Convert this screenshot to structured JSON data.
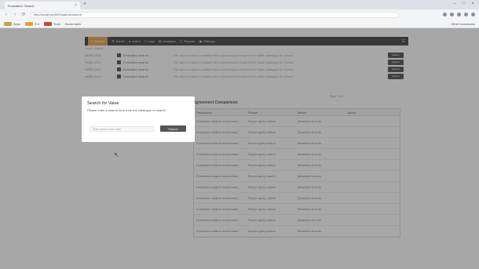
{
  "browser": {
    "tab_title": "Evaluation: Search",
    "new_tab": "+",
    "window_controls": [
      "–",
      "□",
      "×"
    ],
    "back": "‹",
    "forward": "›",
    "reload": "⟳",
    "url": "http://localhost:8000/admin/search"
  },
  "bookmarks": {
    "items": [
      "Apps",
      "Ext",
      "Tools",
      "Bookmarks"
    ],
    "other": "Other bookmarks"
  },
  "nav": {
    "items": [
      "Search",
      "Admin",
      "Users",
      "Logs",
      "Analytics",
      "Reports",
      "Settings"
    ],
    "cart": "☰"
  },
  "breadcrumb": "Home / Search",
  "rows": [
    {
      "id": "#1001-23-0",
      "name": "Evaluation search",
      "desc": "The value is used to validate the current search result in the listed catalogue for review",
      "btn": "Search"
    },
    {
      "id": "#1001-23-1",
      "name": "Evaluation search",
      "desc": "The value is used to validate the current search result in the listed catalogue for review",
      "btn": "Search"
    },
    {
      "id": "#1001-23-2",
      "name": "Evaluation search",
      "desc": "The value is used to validate the current search result in the listed catalogue for review",
      "btn": "Search"
    },
    {
      "id": "#1001-23-3",
      "name": "Evaluation search",
      "desc": "The value is used to validate the current search result in the listed catalogue for review",
      "btn": "Search"
    }
  ],
  "pager": "Page 1 of 1",
  "panel": {
    "title": "Agreement Comparison",
    "headers": [
      "Description",
      "Phrase",
      "Result",
      "Action"
    ],
    "rows": [
      [
        "Evaluation search result value",
        "Simple query match",
        "Matched records",
        ""
      ],
      [
        "Evaluation search result value",
        "Simple query match",
        "Matched records",
        ""
      ],
      [
        "Evaluation search result value",
        "Simple query match",
        "Matched records",
        ""
      ],
      [
        "Evaluation search result value",
        "Simple query match",
        "Matched records",
        ""
      ],
      [
        "Evaluation search result value",
        "Simple query match",
        "Matched records",
        ""
      ],
      [
        "Evaluation search result value",
        "Simple query match",
        "Matched records",
        ""
      ],
      [
        "Evaluation search result value",
        "Simple query match",
        "Matched records",
        ""
      ],
      [
        "Evaluation search result value",
        "Simple query match",
        "Matched records",
        ""
      ],
      [
        "Evaluation search result value",
        "Simple query match",
        "Matched records",
        ""
      ],
      [
        "Evaluation search result value",
        "Simple query match",
        "Matched records",
        ""
      ],
      [
        "Evaluation search result value",
        "Simple query match",
        "Matched records",
        ""
      ]
    ]
  },
  "modal": {
    "title": "Search for Value",
    "text": "Please enter a search term from the catalogue to search.",
    "placeholder": "Enter search term here",
    "button": "Search"
  },
  "colors": {
    "accent": "#e8a33b",
    "nav_bg": "#333333",
    "overlay": "#3c3c3c"
  }
}
